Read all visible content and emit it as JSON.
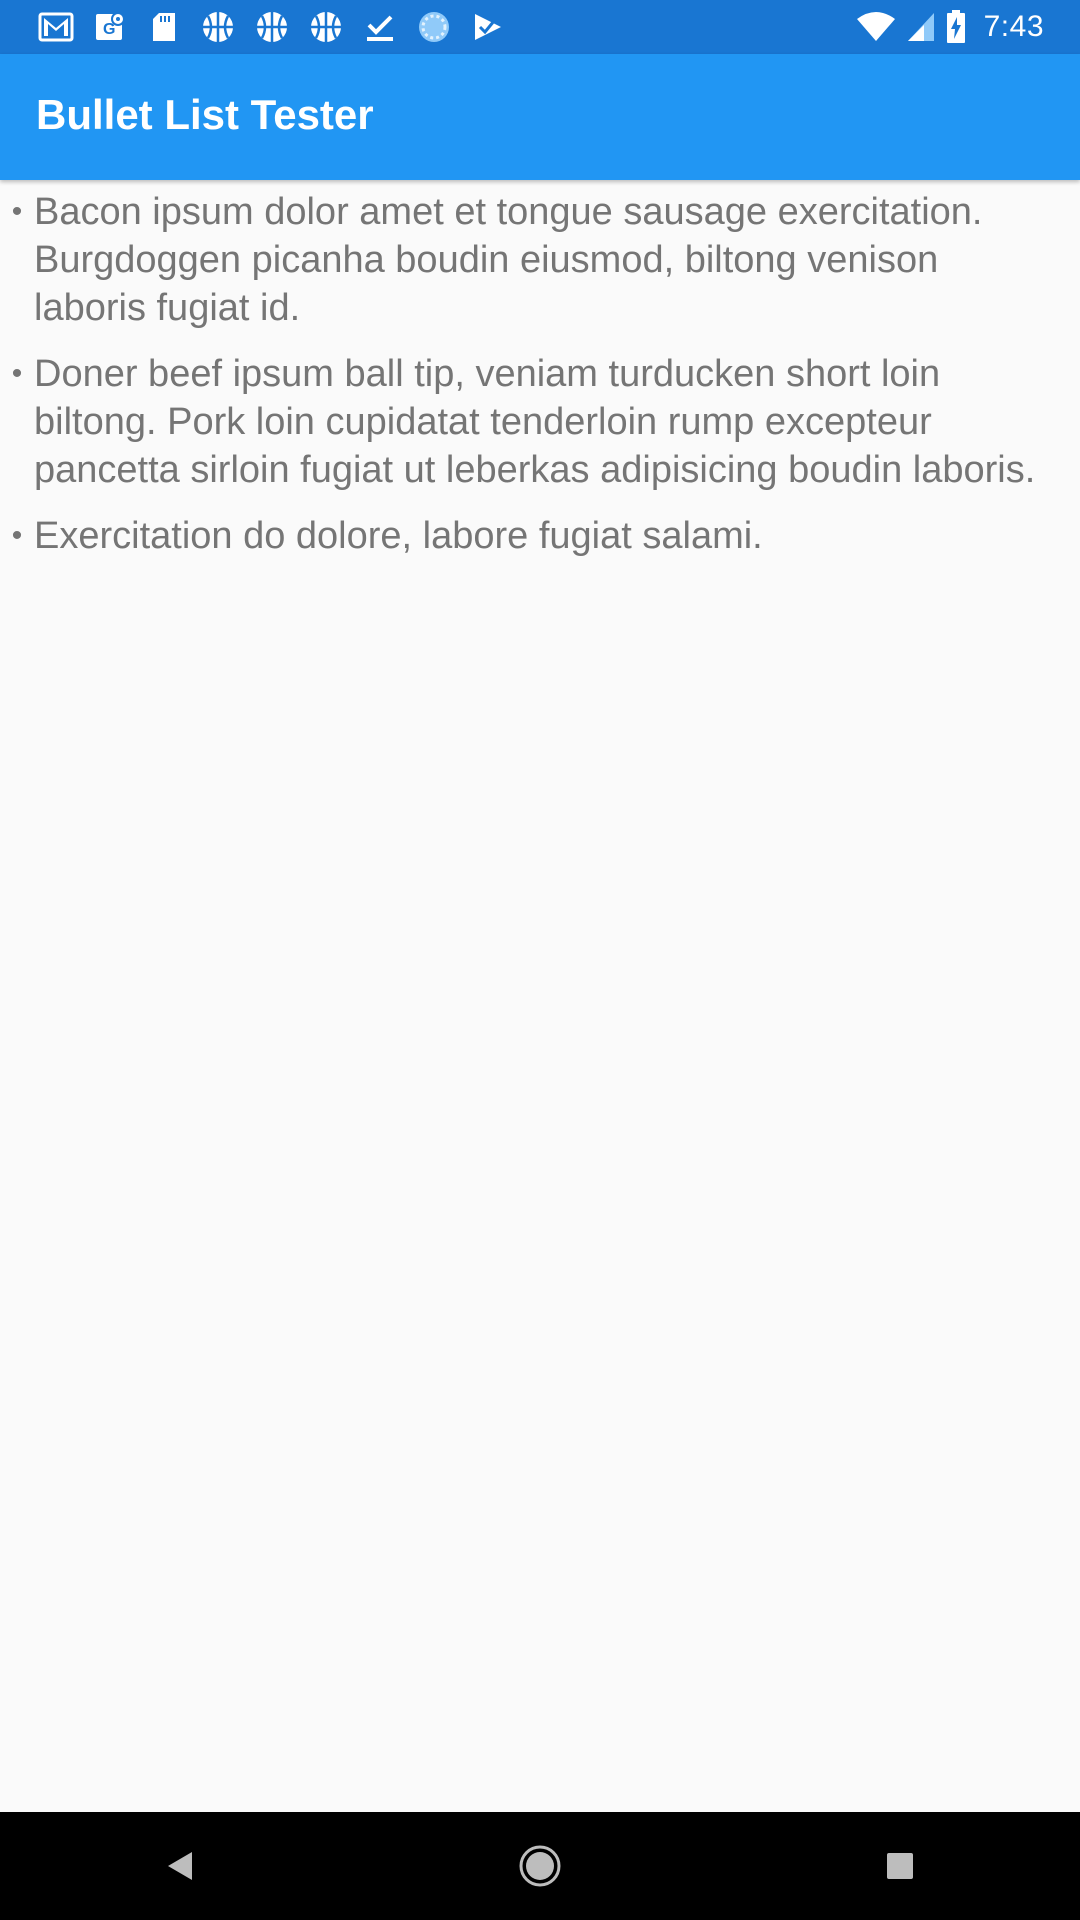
{
  "status_bar": {
    "time": "7:43",
    "notification_icons": [
      "gmail-icon",
      "maps-icon",
      "sd-card-icon",
      "basketball-icon",
      "basketball-icon",
      "basketball-icon",
      "download-done-icon",
      "loading-icon",
      "tasks-icon"
    ],
    "system_icons": [
      "wifi-icon",
      "signal-icon",
      "battery-charging-icon"
    ],
    "color": "#1976d2"
  },
  "app_bar": {
    "title": "Bullet List Tester",
    "color": "#2196f3"
  },
  "bullets": [
    {
      "bullet": "•",
      "text": "Bacon ipsum dolor amet et tongue sausage exercitation. Burgdoggen picanha boudin eiusmod, biltong venison laboris fugiat id."
    },
    {
      "bullet": "•",
      "text": "Doner beef ipsum ball tip, veniam turducken short loin biltong. Pork loin cupidatat tenderloin rump excepteur pancetta sirloin fugiat ut leberkas adipisicing boudin laboris."
    },
    {
      "bullet": "•",
      "text": "Exercitation do dolore, labore fugiat salami."
    }
  ],
  "nav_bar": {
    "buttons": [
      "back-icon",
      "home-icon",
      "recents-icon"
    ]
  }
}
